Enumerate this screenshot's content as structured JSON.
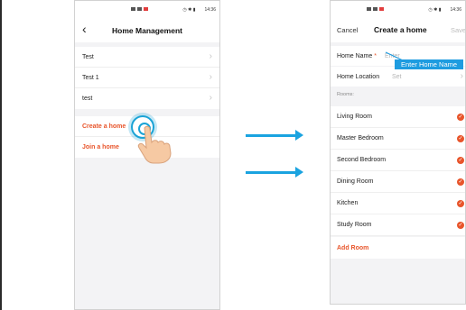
{
  "left_screen": {
    "status_bar": {
      "time": "14:36"
    },
    "nav": {
      "back_icon": "chevron-left-icon",
      "title": "Home Management"
    },
    "homes": [
      {
        "label": "Test"
      },
      {
        "label": "Test 1"
      },
      {
        "label": "test"
      }
    ],
    "actions": [
      {
        "label": "Create a home"
      },
      {
        "label": "Join a home"
      }
    ]
  },
  "right_screen": {
    "status_bar": {
      "time": "14:36"
    },
    "nav": {
      "cancel": "Cancel",
      "title": "Create a home",
      "save": "Save"
    },
    "home_name": {
      "label": "Home Name",
      "required": "*",
      "placeholder": "Enter"
    },
    "home_location": {
      "label": "Home Location",
      "placeholder": "Set"
    },
    "tooltip": "Enter Home Name",
    "rooms_caption": "Rooms:",
    "rooms": [
      {
        "label": "Living Room"
      },
      {
        "label": "Master Bedroom"
      },
      {
        "label": "Second Bedroom"
      },
      {
        "label": "Dining Room"
      },
      {
        "label": "Kitchen"
      },
      {
        "label": "Study Room"
      }
    ],
    "add_room": "Add Room"
  },
  "colors": {
    "accent": "#e8552b",
    "arrow": "#1aa3e0",
    "tooltip": "#1e9ce0"
  }
}
